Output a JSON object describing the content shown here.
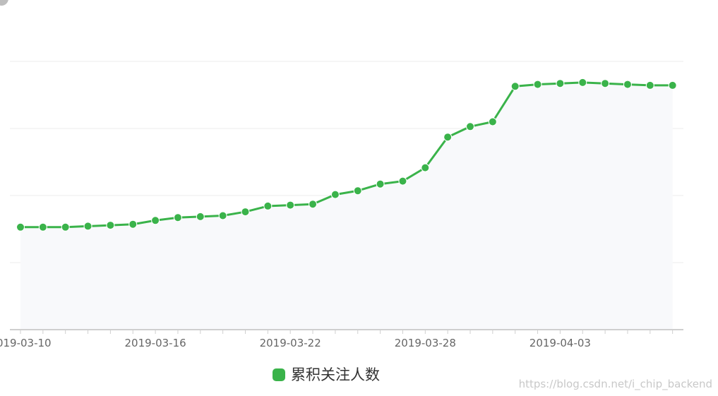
{
  "chart_data": {
    "type": "area",
    "x": [
      "2019-03-10",
      "2019-03-11",
      "2019-03-12",
      "2019-03-13",
      "2019-03-14",
      "2019-03-15",
      "2019-03-16",
      "2019-03-17",
      "2019-03-18",
      "2019-03-19",
      "2019-03-20",
      "2019-03-21",
      "2019-03-22",
      "2019-03-23",
      "2019-03-24",
      "2019-03-25",
      "2019-03-26",
      "2019-03-27",
      "2019-03-28",
      "2019-03-29",
      "2019-03-30",
      "2019-03-31",
      "2019-04-01",
      "2019-04-02",
      "2019-04-03",
      "2019-04-04",
      "2019-04-05",
      "2019-04-06",
      "2019-04-07",
      "2019-04-08"
    ],
    "xticks": [
      "2019-03-10",
      "2019-03-16",
      "2019-03-22",
      "2019-03-28",
      "2019-04-03"
    ],
    "series": [
      {
        "name": "累积关注人数",
        "values": [
          1707,
          1707,
          1707,
          1708,
          1709,
          1710,
          1714,
          1717,
          1718,
          1719,
          1723,
          1729,
          1730,
          1731,
          1741,
          1745,
          1752,
          1755,
          1769,
          1801,
          1812,
          1817,
          1854,
          1856,
          1857,
          1858,
          1857,
          1856,
          1855,
          1855
        ]
      }
    ],
    "ylim": [
      1600,
      1880
    ],
    "grid": true,
    "legend": "bottom-center",
    "title": "",
    "xlabel": "",
    "ylabel": ""
  },
  "colors": {
    "line": "#3ab34a",
    "area": "#f8f9fb",
    "grid": "#eeeeee",
    "axis": "#cfcfcf",
    "tick_text": "#666666"
  },
  "watermark": "https://blog.csdn.net/i_chip_backend"
}
